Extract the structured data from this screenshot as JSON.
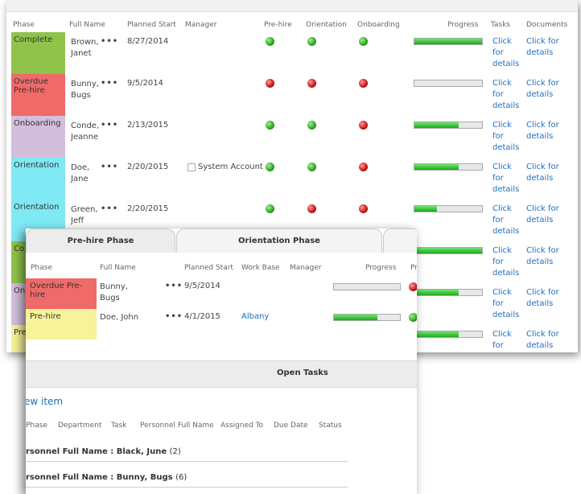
{
  "back": {
    "headers": {
      "phase": "Phase",
      "full_name": "Full Name",
      "planned_start": "Planned Start",
      "manager": "Manager",
      "pre_hire": "Pre-hire",
      "orientation": "Orientation",
      "onboarding": "Onboarding",
      "progress": "Progress",
      "tasks": "Tasks",
      "documents": "Documents"
    },
    "colors": {
      "complete": "#8fc34a",
      "overdue": "#f06a6a",
      "onboarding": "#d2bfdc",
      "orientation": "#7fe9f4",
      "prehire": "#f7f39a"
    },
    "rows": [
      {
        "phase": "Complete",
        "phase_color": "#8fc34a",
        "name": "Brown, Janet",
        "start": "8/27/2014",
        "manager": "",
        "pre": "green",
        "ori": "green",
        "onb": "green",
        "progress": 1.0,
        "tasks": "Click for details",
        "docs": "Click for details"
      },
      {
        "phase": "Overdue Pre-hire",
        "phase_color": "#f06a6a",
        "name": "Bunny, Bugs",
        "start": "9/5/2014",
        "manager": "",
        "pre": "red",
        "ori": "red",
        "onb": "red",
        "progress": 0.0,
        "tasks": "Click for details",
        "docs": "Click for details"
      },
      {
        "phase": "Onboarding",
        "phase_color": "#d2bfdc",
        "name": "Conde, Jeanne",
        "start": "2/13/2015",
        "manager": "",
        "pre": "green",
        "ori": "green",
        "onb": "red",
        "progress": 0.66,
        "tasks": "Click for details",
        "docs": "Click for details"
      },
      {
        "phase": "Orientation",
        "phase_color": "#7fe9f4",
        "name": "Doe, Jane",
        "start": "2/20/2015",
        "manager": "System Account",
        "pre": "green",
        "ori": "green",
        "onb": "red",
        "progress": 0.66,
        "tasks": "Click for details",
        "docs": "Click for details"
      },
      {
        "phase": "Orientation",
        "phase_color": "#7fe9f4",
        "name": "Green, Jeff",
        "start": "2/20/2015",
        "manager": "",
        "pre": "green",
        "ori": "red",
        "onb": "red",
        "progress": 0.33,
        "tasks": "Click for details",
        "docs": "Click for details"
      },
      {
        "phase": "Co",
        "phase_color": "#8fc34a",
        "name": "",
        "start": "",
        "manager": "",
        "pre": "",
        "ori": "",
        "onb": "",
        "progress": 1.0,
        "tasks": "Click for details",
        "docs": "Click for details"
      },
      {
        "phase": "On",
        "phase_color": "#d2bfdc",
        "name": "",
        "start": "",
        "manager": "",
        "pre": "",
        "ori": "",
        "onb": "",
        "progress": 0.66,
        "tasks": "Click for details",
        "docs": "Click for details"
      },
      {
        "phase": "Pre",
        "phase_color": "#f7f39a",
        "name": "",
        "start": "",
        "manager": "",
        "pre": "",
        "ori": "",
        "onb": "",
        "progress": 0.66,
        "tasks": "Click for details",
        "docs": "Click for details"
      }
    ]
  },
  "front": {
    "tabs": [
      "Pre-hire Phase",
      "Orientation Phase"
    ],
    "headers": {
      "phase": "Phase",
      "full_name": "Full Name",
      "planned_start": "Planned Start",
      "work_base": "Work Base",
      "manager": "Manager",
      "progress": "Progress",
      "pr": "Pr"
    },
    "rows": [
      {
        "phase": "Overdue Pre-hire",
        "phase_color": "#f06a6a",
        "name": "Bunny, Bugs",
        "start": "9/5/2014",
        "work_base": "",
        "progress": 0.0,
        "status": "red"
      },
      {
        "phase": "Pre-hire",
        "phase_color": "#f7f39a",
        "name": "Doe, John",
        "start": "4/1/2015",
        "work_base": "Albany",
        "progress": 0.66,
        "status": "green"
      }
    ],
    "open_tasks": {
      "title": "Open Tasks",
      "new_item": "ew item",
      "headers": [
        "Phase",
        "Department",
        "Task",
        "Personnel Full Name",
        "Assigned To",
        "Due Date",
        "Status"
      ],
      "groups": [
        {
          "label": "rsonnel Full Name : Black, June",
          "count": "(2)"
        },
        {
          "label": "rsonnel Full Name : Bunny, Bugs",
          "count": "(6)"
        }
      ]
    }
  }
}
